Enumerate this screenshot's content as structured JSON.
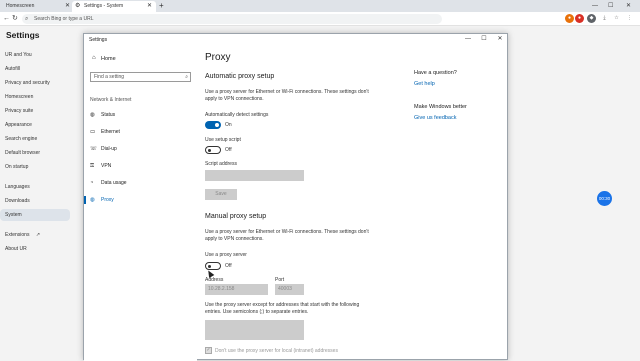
{
  "browser": {
    "tabs": [
      {
        "label": "Homescreen"
      },
      {
        "label": "Settings - System"
      }
    ],
    "new_tab": "+",
    "address_placeholder": "Search Bing or type a URL",
    "minimize": "—",
    "maximize": "☐",
    "close": "✕"
  },
  "sidebar": {
    "title": "Settings",
    "items": [
      {
        "label": "UR and You"
      },
      {
        "label": "Autofill"
      },
      {
        "label": "Privacy and security"
      },
      {
        "label": "Homescreen"
      },
      {
        "label": "Privacy suite"
      },
      {
        "label": "Appearance"
      },
      {
        "label": "Search engine"
      },
      {
        "label": "Default browser"
      },
      {
        "label": "On startup"
      },
      {
        "label": "Languages"
      },
      {
        "label": "Downloads"
      },
      {
        "label": "System"
      },
      {
        "label": "Extensions"
      },
      {
        "label": "About UR"
      }
    ],
    "active": "System"
  },
  "fab": {
    "label": "00:30"
  },
  "window": {
    "title": "Settings",
    "nav": {
      "home": "Home",
      "search_placeholder": "Find a setting",
      "group": "Network & Internet",
      "items": [
        {
          "label": "Status",
          "icon": "globe-icon"
        },
        {
          "label": "Ethernet",
          "icon": "monitor-icon"
        },
        {
          "label": "Dial-up",
          "icon": "phone-icon"
        },
        {
          "label": "VPN",
          "icon": "vpn-icon"
        },
        {
          "label": "Data usage",
          "icon": "data-usage-icon"
        },
        {
          "label": "Proxy",
          "icon": "globe-icon"
        }
      ],
      "selected": "Proxy"
    },
    "content": {
      "title": "Proxy",
      "auto": {
        "heading": "Automatic proxy setup",
        "description": "Use a proxy server for Ethernet or Wi-Fi connections. These settings don't apply to VPN connections.",
        "detect_label": "Automatically detect settings",
        "detect_state": "On",
        "script_label": "Use setup script",
        "script_state": "Off",
        "script_address_label": "Script address",
        "script_address_value": "",
        "save": "Save"
      },
      "manual": {
        "heading": "Manual proxy setup",
        "description": "Use a proxy server for Ethernet or Wi-Fi connections. These settings don't apply to VPN connections.",
        "use_proxy_label": "Use a proxy server",
        "use_proxy_state": "Off",
        "address_label": "Address",
        "address_value": "10.28.2.158",
        "port_label": "Port",
        "port_value": "40003",
        "exceptions_description": "Use the proxy server except for addresses that start with the following entries. Use semicolons (;) to separate entries.",
        "exceptions_value": "",
        "local_label": "Don't use the proxy server for local (intranet) addresses"
      }
    },
    "aside": {
      "question_heading": "Have a question?",
      "get_help": "Get help",
      "better_heading": "Make Windows better",
      "feedback": "Give us feedback"
    }
  },
  "colors": {
    "accent": "#0063b1",
    "browser_accent": "#1a73e8"
  }
}
